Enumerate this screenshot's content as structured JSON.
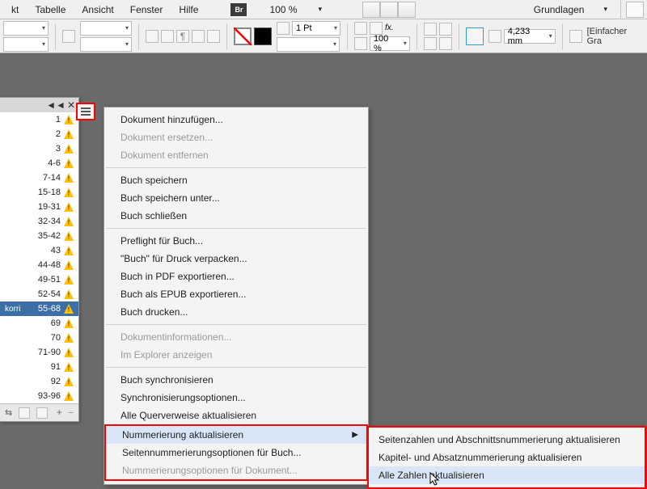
{
  "menubar": {
    "items": [
      "kt",
      "Tabelle",
      "Ansicht",
      "Fenster",
      "Hilfe"
    ],
    "br": "Br",
    "zoom": "100 %",
    "workspace": "Grundlagen"
  },
  "toolbar": {
    "stroke_weight": "1 Pt",
    "scale": "100 %",
    "dim_value": "4,233 mm",
    "frame_fit_label": "[Einfacher Gra"
  },
  "book": {
    "tabbar": {
      "collapse": "◄◄",
      "close": "✕"
    },
    "rows": [
      {
        "pg": "1"
      },
      {
        "pg": "2"
      },
      {
        "pg": "3"
      },
      {
        "pg": "4-6"
      },
      {
        "pg": "7-14"
      },
      {
        "pg": "15-18"
      },
      {
        "pg": "19-31"
      },
      {
        "pg": "32-34"
      },
      {
        "pg": "35-42"
      },
      {
        "pg": "43"
      },
      {
        "pg": "44-48"
      },
      {
        "pg": "49-51"
      },
      {
        "pg": "52-54"
      },
      {
        "pg": "55-68",
        "label": "korri"
      },
      {
        "pg": "69"
      },
      {
        "pg": "70"
      },
      {
        "pg": "71-90"
      },
      {
        "pg": "91"
      },
      {
        "pg": "92"
      },
      {
        "pg": "93-96"
      }
    ],
    "footer_sync": "⇆"
  },
  "ctx": {
    "add_doc": "Dokument hinzufügen...",
    "replace_doc": "Dokument ersetzen...",
    "remove_doc": "Dokument entfernen",
    "save_book": "Buch speichern",
    "save_book_as": "Buch speichern unter...",
    "close_book": "Buch schließen",
    "preflight": "Preflight für Buch...",
    "package": "\"Buch\" für Druck verpacken...",
    "export_pdf": "Buch in PDF exportieren...",
    "export_epub": "Buch als EPUB exportieren...",
    "print": "Buch drucken...",
    "doc_info": "Dokumentinformationen...",
    "reveal": "Im Explorer anzeigen",
    "sync": "Buch synchronisieren",
    "sync_opts": "Synchronisierungsoptionen...",
    "update_xrefs": "Alle Querverweise aktualisieren",
    "update_numbering": "Nummerierung aktualisieren",
    "page_num_opts": "Seitennummerierungsoptionen für Buch...",
    "doc_num_opts": "Nummerierungsoptionen für Dokument..."
  },
  "sub": {
    "page_section": "Seitenzahlen und Abschnittsnummerierung aktualisieren",
    "chapter_para": "Kapitel- und Absatznummerierung aktualisieren",
    "all_numbers": "Alle Zahlen aktualisieren"
  }
}
